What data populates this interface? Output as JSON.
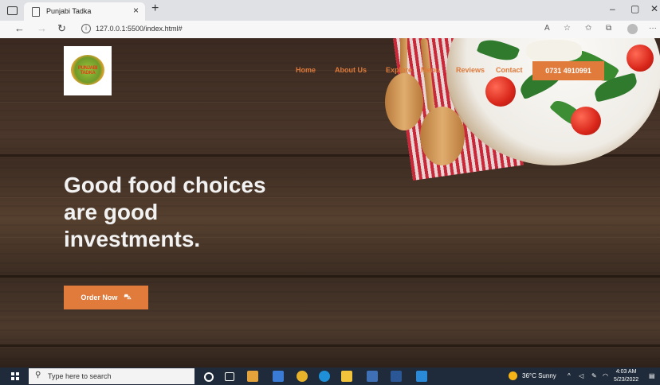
{
  "browser": {
    "tab_title": "Punjabi Tadka",
    "tab_close": "×",
    "new_tab": "+",
    "url": "127.0.0.1:5500/index.html#",
    "url_info": "i",
    "window_controls": [
      "–",
      "▢",
      "✕"
    ],
    "nav_icons": [
      "back-arrow-icon",
      "forward-arrow-icon",
      "refresh-icon",
      "info-icon"
    ],
    "toolbar_icons": [
      "read-aloud-icon",
      "favorite-add-icon",
      "favorites-icon",
      "collections-icon",
      "profile-icon",
      "more-icon"
    ]
  },
  "site": {
    "logo_text": "PUNJABI TADKA",
    "nav": [
      "Home",
      "About Us",
      "Explore",
      "Menu",
      "Reviews",
      "Contact"
    ],
    "phone": "0731 4910991",
    "hero_lines": [
      "Good food choices",
      "are good",
      "investments."
    ],
    "order_button": "Order Now",
    "accent_color": "#e07b3c"
  },
  "taskbar": {
    "search_placeholder": "Type here to search",
    "weather": "36°C  Sunny",
    "time": "4:03 AM",
    "date": "5/23/2022",
    "icons": [
      "start-icon",
      "cortana-icon",
      "task-view-icon",
      "paint-icon",
      "store-icon",
      "chrome-icon",
      "edge-icon",
      "file-explorer-icon",
      "calculator-icon",
      "word-icon",
      "vscode-icon"
    ]
  }
}
